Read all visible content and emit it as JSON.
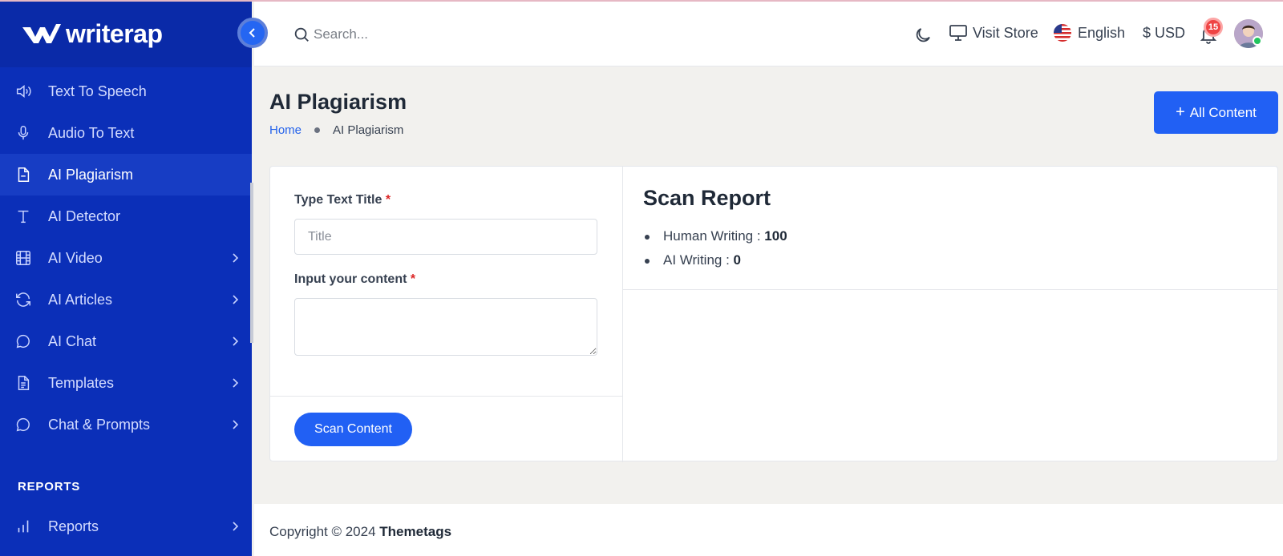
{
  "brand": {
    "name": "writerap"
  },
  "sidebar": {
    "items": [
      {
        "label": "Text To Speech",
        "icon": "speaker-icon",
        "active": false,
        "has_children": false
      },
      {
        "label": "Audio To Text",
        "icon": "microphone-icon",
        "active": false,
        "has_children": false
      },
      {
        "label": "AI Plagiarism",
        "icon": "document-icon",
        "active": true,
        "has_children": false
      },
      {
        "label": "AI Detector",
        "icon": "text-t-icon",
        "active": false,
        "has_children": false
      },
      {
        "label": "AI Video",
        "icon": "film-icon",
        "active": false,
        "has_children": true
      },
      {
        "label": "AI Articles",
        "icon": "refresh-icon",
        "active": false,
        "has_children": true
      },
      {
        "label": "AI Chat",
        "icon": "chat-bubble-icon",
        "active": false,
        "has_children": true
      },
      {
        "label": "Templates",
        "icon": "file-text-icon",
        "active": false,
        "has_children": true
      },
      {
        "label": "Chat & Prompts",
        "icon": "chat-bubble-icon",
        "active": false,
        "has_children": true
      }
    ],
    "section_reports": "REPORTS",
    "reports_item": {
      "label": "Reports",
      "icon": "bar-chart-icon",
      "has_children": true
    }
  },
  "header": {
    "search_placeholder": "Search...",
    "visit_store": "Visit Store",
    "language": "English",
    "currency": "$ USD",
    "notification_count": "15"
  },
  "page": {
    "title": "AI Plagiarism",
    "breadcrumb": {
      "home": "Home",
      "current": "AI Plagiarism"
    },
    "all_content_button": "All Content"
  },
  "form": {
    "title_label": "Type Text Title",
    "title_placeholder": "Title",
    "content_label": "Input your content",
    "required_mark": "*",
    "scan_button": "Scan Content"
  },
  "report": {
    "title": "Scan Report",
    "human_label": "Human Writing : ",
    "human_value": "100",
    "ai_label": "AI Writing : ",
    "ai_value": "0"
  },
  "footer": {
    "copyright_prefix": "Copyright © 2024 ",
    "company": "Themetags"
  },
  "colors": {
    "sidebar_bg": "#0b2fb8",
    "accent": "#2160f4",
    "page_bg": "#f2f1ee"
  }
}
